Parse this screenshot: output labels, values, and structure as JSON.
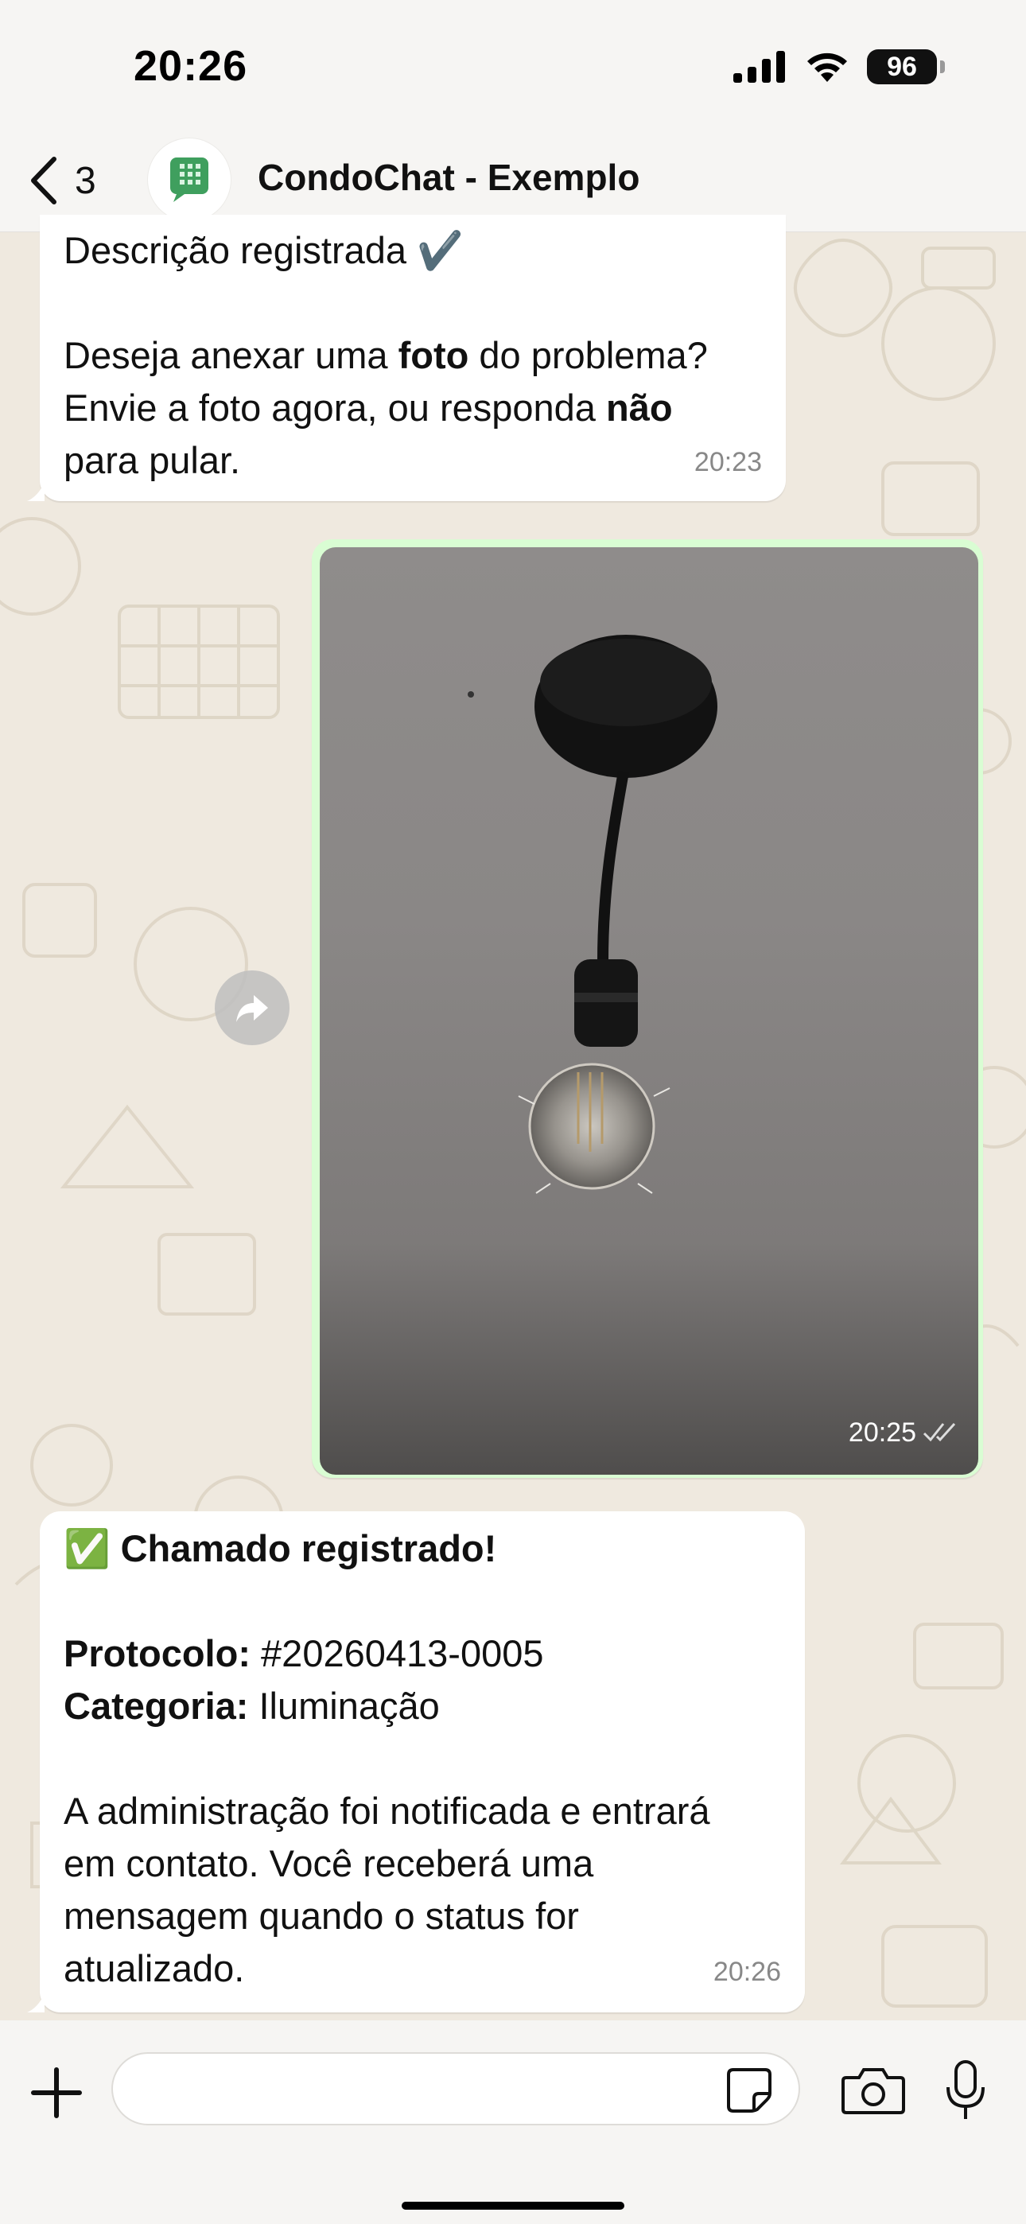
{
  "status_bar": {
    "time": "20:26",
    "battery": "96",
    "icons": [
      "cellular-signal-icon",
      "wifi-icon",
      "battery-icon"
    ]
  },
  "header": {
    "back_count": "3",
    "title": "CondoChat - Exemplo",
    "avatar_icon": "building-chat-icon"
  },
  "messages": [
    {
      "direction": "incoming",
      "time": "20:23",
      "line1": "Descrição registrada ✔️",
      "line2_pre": "Deseja anexar uma ",
      "line2_bold": "foto",
      "line2_post": " do problema?",
      "line3_pre": "Envie a foto agora, ou responda ",
      "line3_bold": "não",
      "line4": "para pular."
    },
    {
      "direction": "outgoing",
      "type": "image",
      "image_description": "light-bulb-on-ceiling",
      "time": "20:25",
      "status": "read-checks"
    },
    {
      "direction": "incoming",
      "time": "20:26",
      "heading_emoji": "✅",
      "heading": "Chamado registrado!",
      "protocol_label": "Protocolo:",
      "protocol_value": " #20260413-0005",
      "category_label": "Categoria:",
      "category_value": " Iluminação",
      "body_line1": "A administração foi notificada e entrará",
      "body_line2": "em contato. Você receberá uma",
      "body_line3": "mensagem quando o status for",
      "body_line4": "atualizado."
    }
  ],
  "input": {
    "value": "",
    "placeholder": ""
  },
  "colors": {
    "outgoing_bubble": "#d9fdd3",
    "incoming_bubble": "#ffffff",
    "wallpaper": "#efe9df",
    "header_bg": "#f6f5f3"
  }
}
